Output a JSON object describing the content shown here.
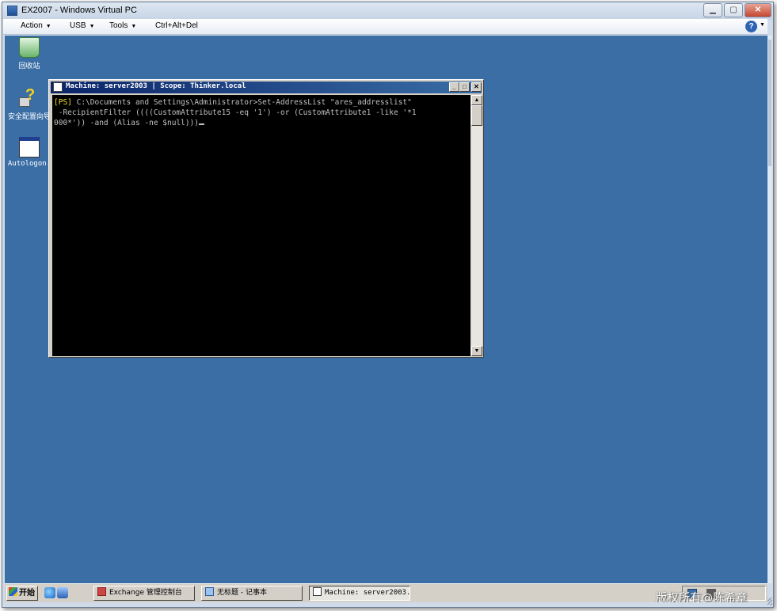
{
  "host": {
    "title": "EX2007 - Windows Virtual PC",
    "menu": [
      "Action",
      "USB",
      "Tools",
      "Ctrl+Alt+Del"
    ],
    "help": "?"
  },
  "desktop": {
    "icons": [
      {
        "label": "回收站"
      },
      {
        "label": "安全配置向导"
      },
      {
        "label": "Autologon."
      }
    ]
  },
  "console": {
    "title": "Machine: server2003 | Scope: Thinker.local",
    "prompt_tag": "[PS]",
    "line1_rest": " C:\\Documents and Settings\\Administrator>Set-AddressList \"ares_addresslist\"",
    "line2": " -RecipientFilter ((((CustomAttribute15 -eq '1') -or (CustomAttribute1 -like '*1",
    "line3": "000*')) -and (Alias -ne $null)))"
  },
  "taskbar": {
    "start_label": "开始",
    "buttons": [
      {
        "label": "Exchange 管理控制台"
      },
      {
        "label": "无标题 - 记事本"
      },
      {
        "label": "Machine: server2003..."
      }
    ]
  },
  "watermark": "版权所有@陈希章"
}
